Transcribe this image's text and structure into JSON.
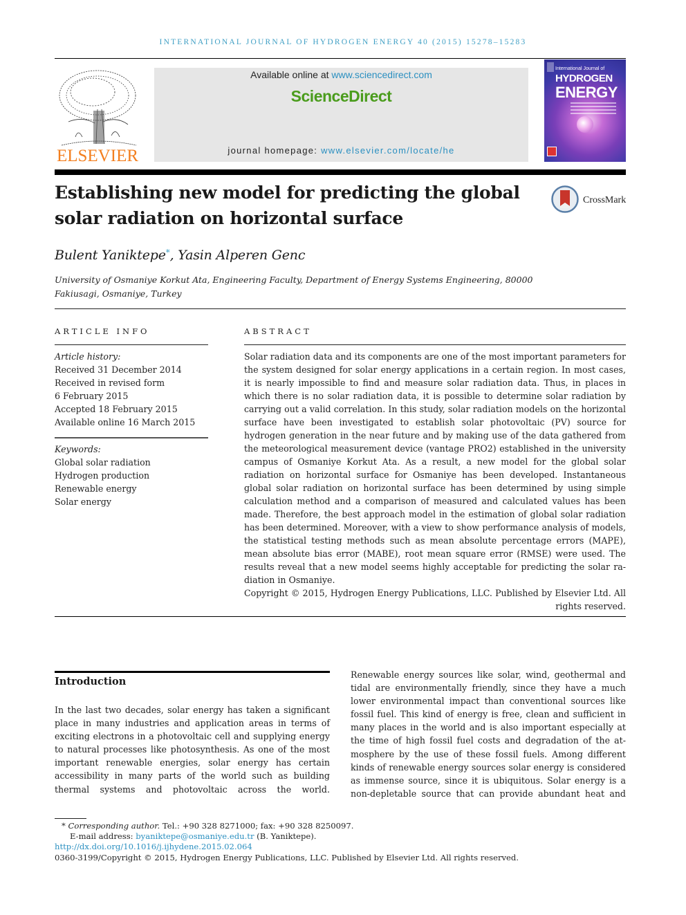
{
  "header": {
    "journal_line": "International Journal of Hydrogen Energy 40 (2015) 15278–15283",
    "publisher_logo_text": "ELSEVIER",
    "available_prefix": "Available online at ",
    "available_link": "www.sciencedirect.com",
    "brand": "ScienceDirect",
    "homepage_prefix": "journal homepage: ",
    "homepage_link": "www.elsevier.com/locate/he",
    "cover": {
      "line1": "International Journal of",
      "line2": "HYDROGEN",
      "line3": "ENERGY"
    },
    "colors": {
      "journal_line": "#3f9fc4",
      "elsevier_orange": "#f37f1f",
      "sciencedirect_green": "#4a9c1c",
      "link_blue": "#2a8fc0"
    }
  },
  "article": {
    "title": "Establishing new model for predicting the global solar radiation on horizontal surface",
    "crossmark_label": "CrossMark",
    "authors": [
      {
        "name": "Bulent Yaniktepe",
        "mark": "*"
      },
      {
        "name": "Yasin Alperen Genc",
        "mark": ""
      }
    ],
    "author_separator": ", ",
    "affiliation": "University of Osmaniye Korkut Ata, Engineering Faculty, Department of Energy Systems Engineering, 80000 Fakiusagi, Osmaniye, Turkey"
  },
  "article_info": {
    "heading": "ARTICLE INFO",
    "history_label": "Article history:",
    "history": [
      "Received 31 December 2014",
      "Received in revised form",
      "6 February 2015",
      "Accepted 18 February 2015",
      "Available online 16 March 2015"
    ],
    "keywords_label": "Keywords:",
    "keywords": [
      "Global solar radiation",
      "Hydrogen production",
      "Renewable energy",
      "Solar energy"
    ]
  },
  "abstract": {
    "heading": "ABSTRACT",
    "text": "Solar radiation data and its components are one of the most important parameters for the system designed for solar energy applications in a certain region. In most cases, it is nearly impossible to find and measure solar radiation data. Thus, in places in which there is no solar radiation data, it is possible to determine solar radiation by carrying out a valid correlation. In this study, solar radiation models on the horizontal surface have been investigated to establish solar photovoltaic (PV) source for hydrogen generation in the near future and by making use of the data gathered from the meteorological measurement device (vantage PRO2) established in the university campus of Osmaniye Korkut Ata. As a result, a new model for the global solar radiation on horizontal surface for Osmaniye has been developed. Instantaneous global solar radiation on horizontal surface has been determined by using simple calculation method and a comparison of measured and calculated values has been made. Therefore, the best approach model in the estimation of global solar radiation has been determined. Moreover, with a view to show performance analysis of models, the statistical testing methods such as mean absolute percentage er­rors (MAPE), mean absolute bias error (MABE), root mean square error (RMSE) were used. The results reveal that a new model seems highly acceptable for predicting the solar ra­diation in Osmaniye.",
    "copyright": "Copyright © 2015, Hydrogen Energy Publications, LLC. Published by Elsevier Ltd. All rights reserved."
  },
  "introduction": {
    "heading": "Introduction",
    "left_column": "In the last two decades, solar energy has taken a significant place in many industries and application areas in terms of exciting electrons in a photovoltaic cell and supplying energy to natural processes like photosynthesis. As one of the most important renewable energies, solar energy has certain accessibility in many parts of the world such as building thermal systems and photovoltaic across the world.",
    "right_column": "Renewable energy sources like solar, wind, geothermal and tidal are environmentally friendly, since they have a much lower environmental impact than conventional sources like fossil fuel. This kind of energy is free, clean and sufficient in many places in the world and is also important especially at the time of high fossil fuel costs and degradation of the at­mosphere by the use of these fossil fuels. Among different kinds of renewable energy sources solar energy is considered as immense source, since it is ubiquitous. Solar energy is a non-depletable source that can provide abundant heat and"
  },
  "footnotes": {
    "corresponding_mark": "*",
    "corresponding_label": "Corresponding author.",
    "contact": " Tel.: +90 328 8271000; fax: +90 328 8250097.",
    "email_prefix": "E-mail address: ",
    "email": "byaniktepe@osmaniye.edu.tr",
    "email_suffix": " (B. Yaniktepe).",
    "doi": "http://dx.doi.org/10.1016/j.ijhydene.2015.02.064",
    "issn_copyright": "0360-3199/Copyright © 2015, Hydrogen Energy Publications, LLC. Published by Elsevier Ltd. All rights reserved."
  }
}
